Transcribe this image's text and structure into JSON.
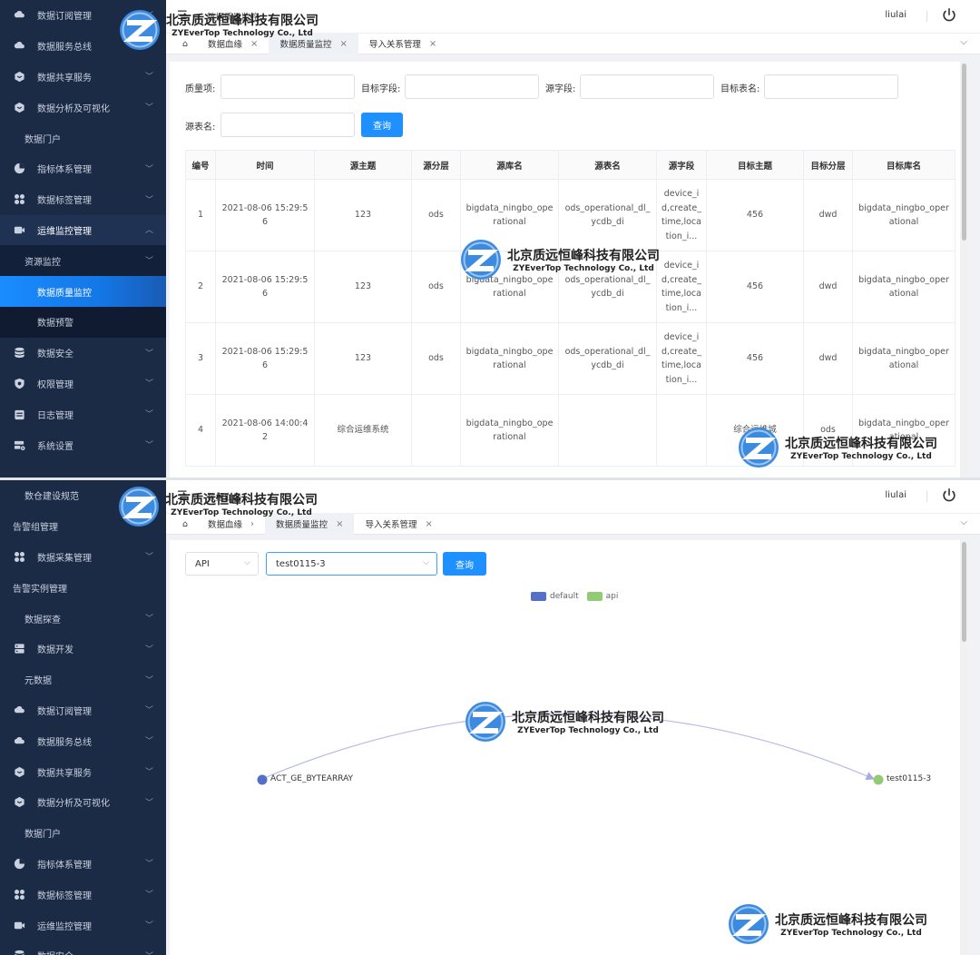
{
  "watermark": {
    "name_cn": "北京质远恒峰科技有限公司",
    "name_en": "ZYEverTop Technology Co., Ltd"
  },
  "panel1": {
    "sidebar": [
      {
        "label": "数据订阅管理",
        "icon": "cloud-icon",
        "arrow": "chevron-down"
      },
      {
        "label": "数据服务总线",
        "icon": "cloud-icon",
        "arrow": "chevron-down"
      },
      {
        "label": "数据共享服务",
        "icon": "cube-icon",
        "arrow": "chevron-down"
      },
      {
        "label": "数据分析及可视化",
        "icon": "cube-icon",
        "arrow": "chevron-down"
      },
      {
        "label": "数据门户",
        "icon": "",
        "arrow": ""
      },
      {
        "label": "指标体系管理",
        "icon": "pie-icon",
        "arrow": "chevron-down"
      },
      {
        "label": "数据标签管理",
        "icon": "apps-icon",
        "arrow": "chevron-down"
      },
      {
        "label": "运维监控管理",
        "icon": "video-icon",
        "arrow": "chevron-up"
      },
      {
        "label": "资源监控",
        "icon": "",
        "arrow": "chevron-down"
      },
      {
        "label": "数据质量监控",
        "icon": "",
        "arrow": ""
      },
      {
        "label": "数据预警",
        "icon": "",
        "arrow": ""
      },
      {
        "label": "数据安全",
        "icon": "database-icon",
        "arrow": "chevron-down"
      },
      {
        "label": "权限管理",
        "icon": "shield-icon",
        "arrow": "chevron-down"
      },
      {
        "label": "日志管理",
        "icon": "calendar-icon",
        "arrow": "chevron-down"
      },
      {
        "label": "系统设置",
        "icon": "server-gear-icon",
        "arrow": "chevron-down"
      }
    ],
    "breadcrumb": "数据质量监控",
    "user": "liulai",
    "tabs": [
      {
        "label": "数据血缘",
        "closable": true
      },
      {
        "label": "数据质量监控",
        "closable": true
      },
      {
        "label": "导入关系管理",
        "closable": true
      }
    ],
    "filters": [
      {
        "label": "质量项:",
        "value": ""
      },
      {
        "label": "目标字段:",
        "value": ""
      },
      {
        "label": "源字段:",
        "value": ""
      },
      {
        "label": "目标表名:",
        "value": ""
      },
      {
        "label": "源表名:",
        "value": ""
      }
    ],
    "query_label": "查询",
    "columns": [
      "编号",
      "时间",
      "源主题",
      "源分层",
      "源库名",
      "源表名",
      "源字段",
      "目标主题",
      "目标分层",
      "目标库名"
    ],
    "rows": [
      [
        "1",
        "2021-08-06 15:29:56",
        "123",
        "ods",
        "bigdata_ningbo_operational",
        "ods_operational_dl_ycdb_di",
        "device_id,create_time,location_i...",
        "456",
        "dwd",
        "bigdata_ningbo_operational"
      ],
      [
        "2",
        "2021-08-06 15:29:56",
        "123",
        "ods",
        "bigdata_ningbo_operational",
        "ods_operational_dl_ycdb_di",
        "device_id,create_time,location_i...",
        "456",
        "dwd",
        "bigdata_ningbo_operational"
      ],
      [
        "3",
        "2021-08-06 15:29:56",
        "123",
        "ods",
        "bigdata_ningbo_operational",
        "ods_operational_dl_ycdb_di",
        "device_id,create_time,location_i...",
        "456",
        "dwd",
        "bigdata_ningbo_operational"
      ],
      [
        "4",
        "2021-08-06 14:00:42",
        "综合运维系统",
        "",
        "bigdata_ningbo_operational",
        "",
        "",
        "综合运维城",
        "ods",
        "bigdata_ningbo_operational"
      ]
    ]
  },
  "panel2": {
    "sidebar": [
      {
        "label": "数仓建设规范",
        "icon": "",
        "arrow": "",
        "style": "sub-plain"
      },
      {
        "label": "告警组管理",
        "icon": "",
        "arrow": "",
        "style": "flat"
      },
      {
        "label": "数据采集管理",
        "icon": "apps-icon",
        "arrow": "chevron-down",
        "style": ""
      },
      {
        "label": "告警实例管理",
        "icon": "",
        "arrow": "",
        "style": "flat"
      },
      {
        "label": "数据探查",
        "icon": "",
        "arrow": "chevron-down",
        "style": "sub-plain"
      },
      {
        "label": "数据开发",
        "icon": "server-icon",
        "arrow": "chevron-down",
        "style": ""
      },
      {
        "label": "元数据",
        "icon": "",
        "arrow": "chevron-down",
        "style": "sub-plain"
      },
      {
        "label": "数据订阅管理",
        "icon": "cloud-icon",
        "arrow": "chevron-down",
        "style": ""
      },
      {
        "label": "数据服务总线",
        "icon": "cloud-icon",
        "arrow": "chevron-down",
        "style": ""
      },
      {
        "label": "数据共享服务",
        "icon": "cube-icon",
        "arrow": "chevron-down",
        "style": ""
      },
      {
        "label": "数据分析及可视化",
        "icon": "cube-icon",
        "arrow": "chevron-down",
        "style": ""
      },
      {
        "label": "数据门户",
        "icon": "",
        "arrow": "",
        "style": "sub-plain"
      },
      {
        "label": "指标体系管理",
        "icon": "pie-icon",
        "arrow": "chevron-down",
        "style": ""
      },
      {
        "label": "数据标签管理",
        "icon": "apps-icon",
        "arrow": "chevron-down",
        "style": ""
      },
      {
        "label": "运维监控管理",
        "icon": "video-icon",
        "arrow": "chevron-down",
        "style": ""
      },
      {
        "label": "数据安全",
        "icon": "database-icon",
        "arrow": "chevron-down",
        "style": ""
      }
    ],
    "breadcrumb": "数据血缘",
    "user": "liulai",
    "tabs": [
      {
        "label": "数据血缘",
        "closable": false
      },
      {
        "label": "数据质量监控",
        "closable": false
      },
      {
        "label": "导入关系管理",
        "closable": true
      }
    ],
    "type_select": "API",
    "name_select": "test0115-3",
    "query_label": "查询",
    "legend": [
      {
        "name": "default",
        "color": "#5470c6"
      },
      {
        "name": "api",
        "color": "#91cc75"
      }
    ],
    "graph": {
      "nodes": [
        {
          "name": "ACT_GE_BYTEARRAY",
          "category": "default"
        },
        {
          "name": "test0115-3",
          "category": "api"
        }
      ],
      "edges": [
        {
          "source": "ACT_GE_BYTEARRAY",
          "target": "test0115-3"
        }
      ]
    }
  }
}
